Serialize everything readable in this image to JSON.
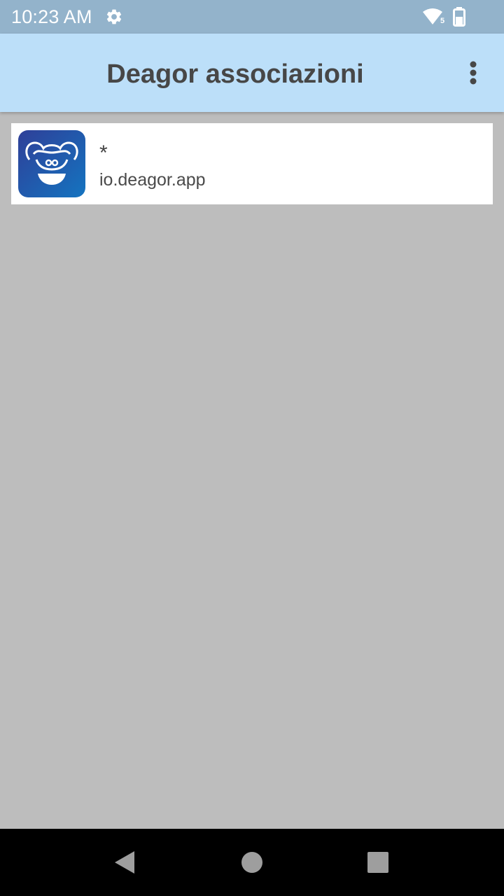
{
  "status_bar": {
    "time": "10:23 AM",
    "settings_icon": "gear-icon",
    "wifi_icon": "wifi-icon",
    "wifi_badge": "5",
    "battery_icon": "battery-icon",
    "background_color": "#93b3cb"
  },
  "app_bar": {
    "title": "Deagor associazioni",
    "menu_icon": "more-vert-icon",
    "background_color": "#bcdff9"
  },
  "list": {
    "items": [
      {
        "title": "*",
        "subtitle": "io.deagor.app",
        "icon": "deagor-logo-icon"
      }
    ]
  },
  "nav_bar": {
    "back_icon": "back-triangle-icon",
    "home_icon": "home-circle-icon",
    "recents_icon": "recents-square-icon"
  },
  "colors": {
    "page_background": "#bdbdbd",
    "title_text": "#474747",
    "logo_gradient_start": "#2f3f98",
    "logo_gradient_end": "#1474c0"
  }
}
